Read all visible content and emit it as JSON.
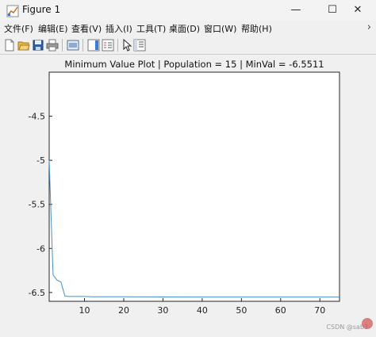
{
  "window": {
    "title": "Figure 1",
    "controls": {
      "minimize": "—",
      "maximize": "☐",
      "close": "✕"
    }
  },
  "menu": {
    "items": [
      "文件(F)",
      "编辑(E)",
      "查看(V)",
      "插入(I)",
      "工具(T)",
      "桌面(D)",
      "窗口(W)",
      "帮助(H)"
    ],
    "overflow_icon": "chevron-right-icon"
  },
  "toolbar": {
    "icons": [
      "new-figure-icon",
      "open-file-icon",
      "save-icon",
      "print-icon",
      "link-plot-icon",
      "insert-colorbar-icon",
      "insert-legend-icon",
      "pointer-icon",
      "property-inspector-icon"
    ]
  },
  "chart_data": {
    "type": "line",
    "title": "Minimum Value Plot | Population = 15 | MinVal = -6.5511",
    "xlabel": "",
    "ylabel": "",
    "xlim": [
      1,
      75
    ],
    "ylim": [
      -6.6,
      -4.0
    ],
    "xticks": [
      "10",
      "20",
      "30",
      "40",
      "50",
      "60",
      "70"
    ],
    "yticks": [
      "-4.5",
      "-5",
      "-5.5",
      "-6",
      "-6.5"
    ],
    "grid": false,
    "series": [
      {
        "color": "#4a8ec8",
        "x": [
          1,
          2,
          3,
          4,
          5,
          6,
          8,
          10,
          12,
          15,
          20,
          30,
          40,
          50,
          60,
          70,
          75
        ],
        "y": [
          -5.0,
          -6.3,
          -6.36,
          -6.38,
          -6.54,
          -6.545,
          -6.545,
          -6.545,
          -6.549,
          -6.549,
          -6.549,
          -6.5505,
          -6.551,
          -6.551,
          -6.5511,
          -6.5511,
          -6.5511
        ]
      }
    ]
  },
  "watermark": "CSDN @sab3"
}
